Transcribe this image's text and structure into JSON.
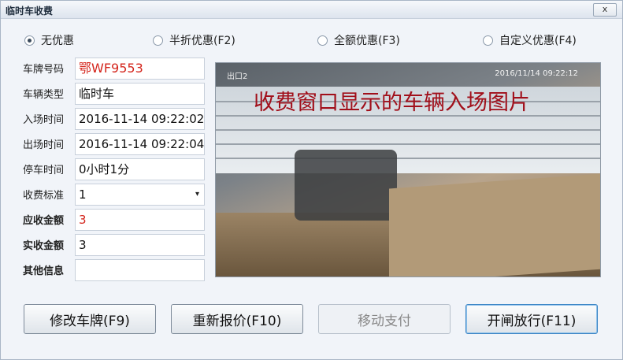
{
  "window": {
    "title": "临时车收费",
    "close_glyph": "x"
  },
  "discount": [
    {
      "label": "无优惠",
      "selected": true
    },
    {
      "label": "半折优惠(F2)",
      "selected": false
    },
    {
      "label": "全额优惠(F3)",
      "selected": false
    },
    {
      "label": "自定义优惠(F4)",
      "selected": false
    }
  ],
  "form": {
    "plate_label": "车牌号码",
    "plate_value": "鄂WF9553",
    "type_label": "车辆类型",
    "type_value": "临时车",
    "entry_label": "入场时间",
    "entry_value": "2016-11-14 09:22:02",
    "exit_label": "出场时间",
    "exit_value": "2016-11-14 09:22:04",
    "duration_label": "停车时间",
    "duration_value": "0小时1分",
    "standard_label": "收费标准",
    "standard_value": "1",
    "standard_caret": "▾",
    "due_label": "应收金额",
    "due_value": "3",
    "paid_label": "实收金额",
    "paid_value": "3",
    "other_label": "其他信息",
    "other_value": ""
  },
  "photo": {
    "overlay_text": "收费窗口显示的车辆入场图片",
    "camera_label": "出口2",
    "timestamp": "2016/11/14  09:22:12"
  },
  "buttons": {
    "edit_plate": "修改车牌(F9)",
    "requote": "重新报价(F10)",
    "mobile_pay": "移动支付",
    "open_gate": "开闸放行(F11)"
  },
  "colors": {
    "accent_red": "#d4251c",
    "overlay_red": "#a10f1a"
  }
}
